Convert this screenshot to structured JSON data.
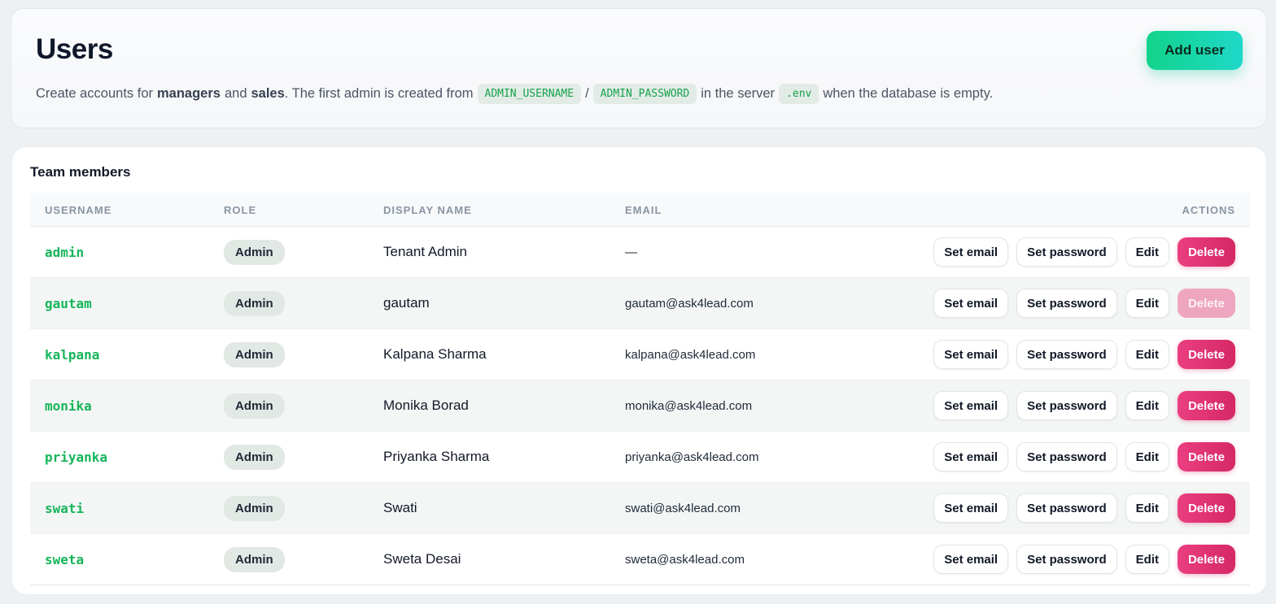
{
  "header": {
    "title": "Users",
    "add_user_label": "Add user",
    "desc_prefix": "Create accounts for",
    "desc_managers": "managers",
    "desc_and": "and",
    "desc_sales": "sales",
    "desc_mid": ". The first admin is created from",
    "code_username": "ADMIN_USERNAME",
    "desc_slash": "/",
    "code_password": "ADMIN_PASSWORD",
    "desc_server": "in the server",
    "code_env": ".env",
    "desc_suffix": "when the database is empty."
  },
  "team": {
    "title": "Team members",
    "columns": {
      "username": "USERNAME",
      "role": "ROLE",
      "display_name": "DISPLAY NAME",
      "email": "EMAIL",
      "actions": "ACTIONS"
    },
    "action_labels": {
      "set_email": "Set email",
      "set_password": "Set password",
      "edit": "Edit",
      "delete": "Delete"
    },
    "rows": [
      {
        "username": "admin",
        "role": "Admin",
        "display_name": "Tenant Admin",
        "email": "—",
        "delete_disabled": false
      },
      {
        "username": "gautam",
        "role": "Admin",
        "display_name": "gautam",
        "email": "gautam@ask4lead.com",
        "delete_disabled": true
      },
      {
        "username": "kalpana",
        "role": "Admin",
        "display_name": "Kalpana Sharma",
        "email": "kalpana@ask4lead.com",
        "delete_disabled": false
      },
      {
        "username": "monika",
        "role": "Admin",
        "display_name": "Monika Borad",
        "email": "monika@ask4lead.com",
        "delete_disabled": false
      },
      {
        "username": "priyanka",
        "role": "Admin",
        "display_name": "Priyanka Sharma",
        "email": "priyanka@ask4lead.com",
        "delete_disabled": false
      },
      {
        "username": "swati",
        "role": "Admin",
        "display_name": "Swati",
        "email": "swati@ask4lead.com",
        "delete_disabled": false
      },
      {
        "username": "sweta",
        "role": "Admin",
        "display_name": "Sweta Desai",
        "email": "sweta@ask4lead.com",
        "delete_disabled": false
      }
    ]
  },
  "colors": {
    "accent_green": "#16b55a",
    "delete_pink": "#e33a7a",
    "add_user_gradient_start": "#12d38a",
    "add_user_gradient_end": "#1fd8c9"
  }
}
